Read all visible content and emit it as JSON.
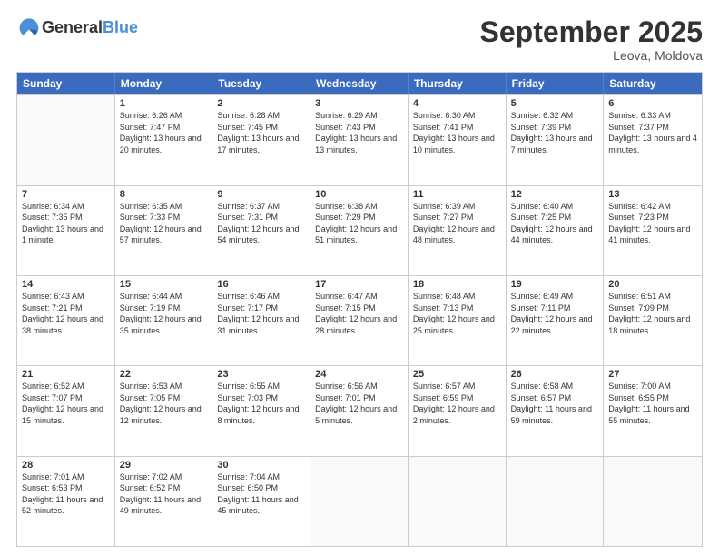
{
  "header": {
    "logo_general": "General",
    "logo_blue": "Blue",
    "month_title": "September 2025",
    "location": "Leova, Moldova"
  },
  "weekdays": [
    "Sunday",
    "Monday",
    "Tuesday",
    "Wednesday",
    "Thursday",
    "Friday",
    "Saturday"
  ],
  "weeks": [
    [
      {
        "day": "",
        "empty": true
      },
      {
        "day": "1",
        "sunrise": "6:26 AM",
        "sunset": "7:47 PM",
        "daylight": "13 hours and 20 minutes."
      },
      {
        "day": "2",
        "sunrise": "6:28 AM",
        "sunset": "7:45 PM",
        "daylight": "13 hours and 17 minutes."
      },
      {
        "day": "3",
        "sunrise": "6:29 AM",
        "sunset": "7:43 PM",
        "daylight": "13 hours and 13 minutes."
      },
      {
        "day": "4",
        "sunrise": "6:30 AM",
        "sunset": "7:41 PM",
        "daylight": "13 hours and 10 minutes."
      },
      {
        "day": "5",
        "sunrise": "6:32 AM",
        "sunset": "7:39 PM",
        "daylight": "13 hours and 7 minutes."
      },
      {
        "day": "6",
        "sunrise": "6:33 AM",
        "sunset": "7:37 PM",
        "daylight": "13 hours and 4 minutes."
      }
    ],
    [
      {
        "day": "7",
        "sunrise": "6:34 AM",
        "sunset": "7:35 PM",
        "daylight": "13 hours and 1 minute."
      },
      {
        "day": "8",
        "sunrise": "6:35 AM",
        "sunset": "7:33 PM",
        "daylight": "12 hours and 57 minutes."
      },
      {
        "day": "9",
        "sunrise": "6:37 AM",
        "sunset": "7:31 PM",
        "daylight": "12 hours and 54 minutes."
      },
      {
        "day": "10",
        "sunrise": "6:38 AM",
        "sunset": "7:29 PM",
        "daylight": "12 hours and 51 minutes."
      },
      {
        "day": "11",
        "sunrise": "6:39 AM",
        "sunset": "7:27 PM",
        "daylight": "12 hours and 48 minutes."
      },
      {
        "day": "12",
        "sunrise": "6:40 AM",
        "sunset": "7:25 PM",
        "daylight": "12 hours and 44 minutes."
      },
      {
        "day": "13",
        "sunrise": "6:42 AM",
        "sunset": "7:23 PM",
        "daylight": "12 hours and 41 minutes."
      }
    ],
    [
      {
        "day": "14",
        "sunrise": "6:43 AM",
        "sunset": "7:21 PM",
        "daylight": "12 hours and 38 minutes."
      },
      {
        "day": "15",
        "sunrise": "6:44 AM",
        "sunset": "7:19 PM",
        "daylight": "12 hours and 35 minutes."
      },
      {
        "day": "16",
        "sunrise": "6:46 AM",
        "sunset": "7:17 PM",
        "daylight": "12 hours and 31 minutes."
      },
      {
        "day": "17",
        "sunrise": "6:47 AM",
        "sunset": "7:15 PM",
        "daylight": "12 hours and 28 minutes."
      },
      {
        "day": "18",
        "sunrise": "6:48 AM",
        "sunset": "7:13 PM",
        "daylight": "12 hours and 25 minutes."
      },
      {
        "day": "19",
        "sunrise": "6:49 AM",
        "sunset": "7:11 PM",
        "daylight": "12 hours and 22 minutes."
      },
      {
        "day": "20",
        "sunrise": "6:51 AM",
        "sunset": "7:09 PM",
        "daylight": "12 hours and 18 minutes."
      }
    ],
    [
      {
        "day": "21",
        "sunrise": "6:52 AM",
        "sunset": "7:07 PM",
        "daylight": "12 hours and 15 minutes."
      },
      {
        "day": "22",
        "sunrise": "6:53 AM",
        "sunset": "7:05 PM",
        "daylight": "12 hours and 12 minutes."
      },
      {
        "day": "23",
        "sunrise": "6:55 AM",
        "sunset": "7:03 PM",
        "daylight": "12 hours and 8 minutes."
      },
      {
        "day": "24",
        "sunrise": "6:56 AM",
        "sunset": "7:01 PM",
        "daylight": "12 hours and 5 minutes."
      },
      {
        "day": "25",
        "sunrise": "6:57 AM",
        "sunset": "6:59 PM",
        "daylight": "12 hours and 2 minutes."
      },
      {
        "day": "26",
        "sunrise": "6:58 AM",
        "sunset": "6:57 PM",
        "daylight": "11 hours and 59 minutes."
      },
      {
        "day": "27",
        "sunrise": "7:00 AM",
        "sunset": "6:55 PM",
        "daylight": "11 hours and 55 minutes."
      }
    ],
    [
      {
        "day": "28",
        "sunrise": "7:01 AM",
        "sunset": "6:53 PM",
        "daylight": "11 hours and 52 minutes."
      },
      {
        "day": "29",
        "sunrise": "7:02 AM",
        "sunset": "6:52 PM",
        "daylight": "11 hours and 49 minutes."
      },
      {
        "day": "30",
        "sunrise": "7:04 AM",
        "sunset": "6:50 PM",
        "daylight": "11 hours and 45 minutes."
      },
      {
        "day": "",
        "empty": true
      },
      {
        "day": "",
        "empty": true
      },
      {
        "day": "",
        "empty": true
      },
      {
        "day": "",
        "empty": true
      }
    ]
  ]
}
